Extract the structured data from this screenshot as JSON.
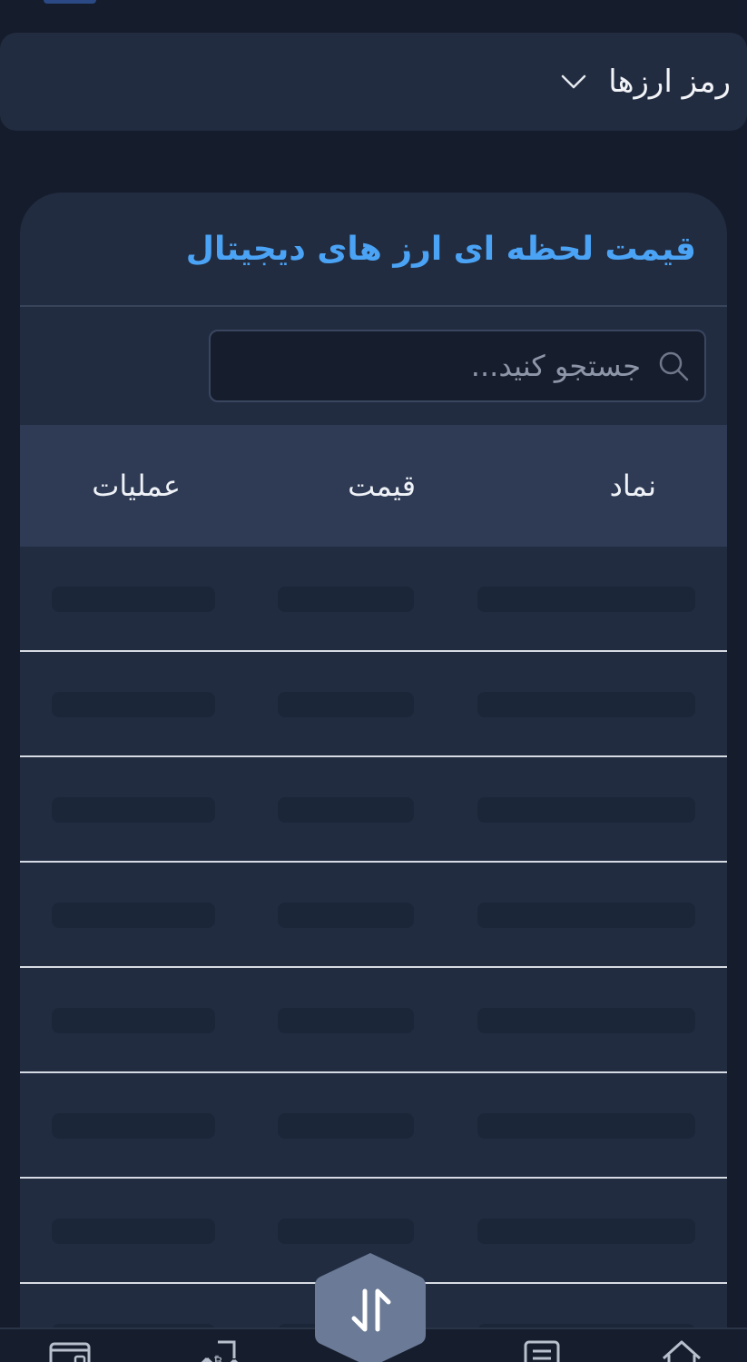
{
  "dropdown": {
    "label": "رمز ارزها"
  },
  "card": {
    "title": "قیمت لحظه ای ارز های دیجیتال"
  },
  "search": {
    "placeholder": "جستجو کنید..."
  },
  "table": {
    "headers": {
      "symbol": "نماد",
      "price": "قیمت",
      "operations": "عملیات"
    },
    "loading_rows": 8
  },
  "icons": {
    "dropdown": "chevron-down-icon",
    "search": "search-icon",
    "fab": "swap-arrows-icon",
    "nav": [
      "wallet-icon",
      "exchange-icon",
      "orders-icon",
      "home-icon"
    ]
  },
  "colors": {
    "background": "#151c2b",
    "surface": "#212c41",
    "header": "#2f3b55",
    "accent": "#4ba3f5",
    "fab": "#6b7a96"
  }
}
